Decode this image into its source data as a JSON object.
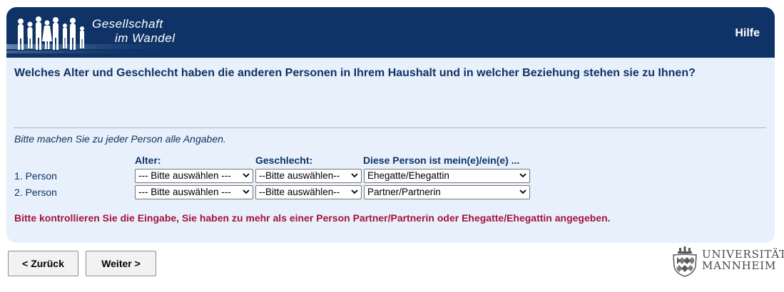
{
  "header": {
    "logo_line1": "Gesellschaft",
    "logo_line2": "im Wandel",
    "help": "Hilfe"
  },
  "question": "Welches Alter und Geschlecht haben die anderen Personen in Ihrem Haushalt und in welcher Beziehung stehen sie zu Ihnen?",
  "hint": "Bitte machen Sie zu jeder Person alle Angaben.",
  "columns": {
    "age": "Alter:",
    "gender": "Geschlecht:",
    "relation": "Diese Person ist mein(e)/ein(e) ..."
  },
  "rows": [
    {
      "label": "1. Person",
      "age": "--- Bitte auswählen ---",
      "gender": "--Bitte auswählen--",
      "relation": "Ehegatte/Ehegattin"
    },
    {
      "label": "2. Person",
      "age": "--- Bitte auswählen ---",
      "gender": "--Bitte auswählen--",
      "relation": "Partner/Partnerin"
    }
  ],
  "error": "Bitte kontrollieren Sie die Eingabe, Sie haben zu mehr als einer Person Partner/Partnerin oder Ehegatte/Ehegattin angegeben.",
  "nav": {
    "back": "< Zurück",
    "next": "Weiter >"
  },
  "university": {
    "line1": "UNIVERSITÄT",
    "line2": "MANNHEIM"
  },
  "colors": {
    "header": "#0f3366",
    "panel": "#e8f1fb",
    "error": "#a3123a"
  }
}
